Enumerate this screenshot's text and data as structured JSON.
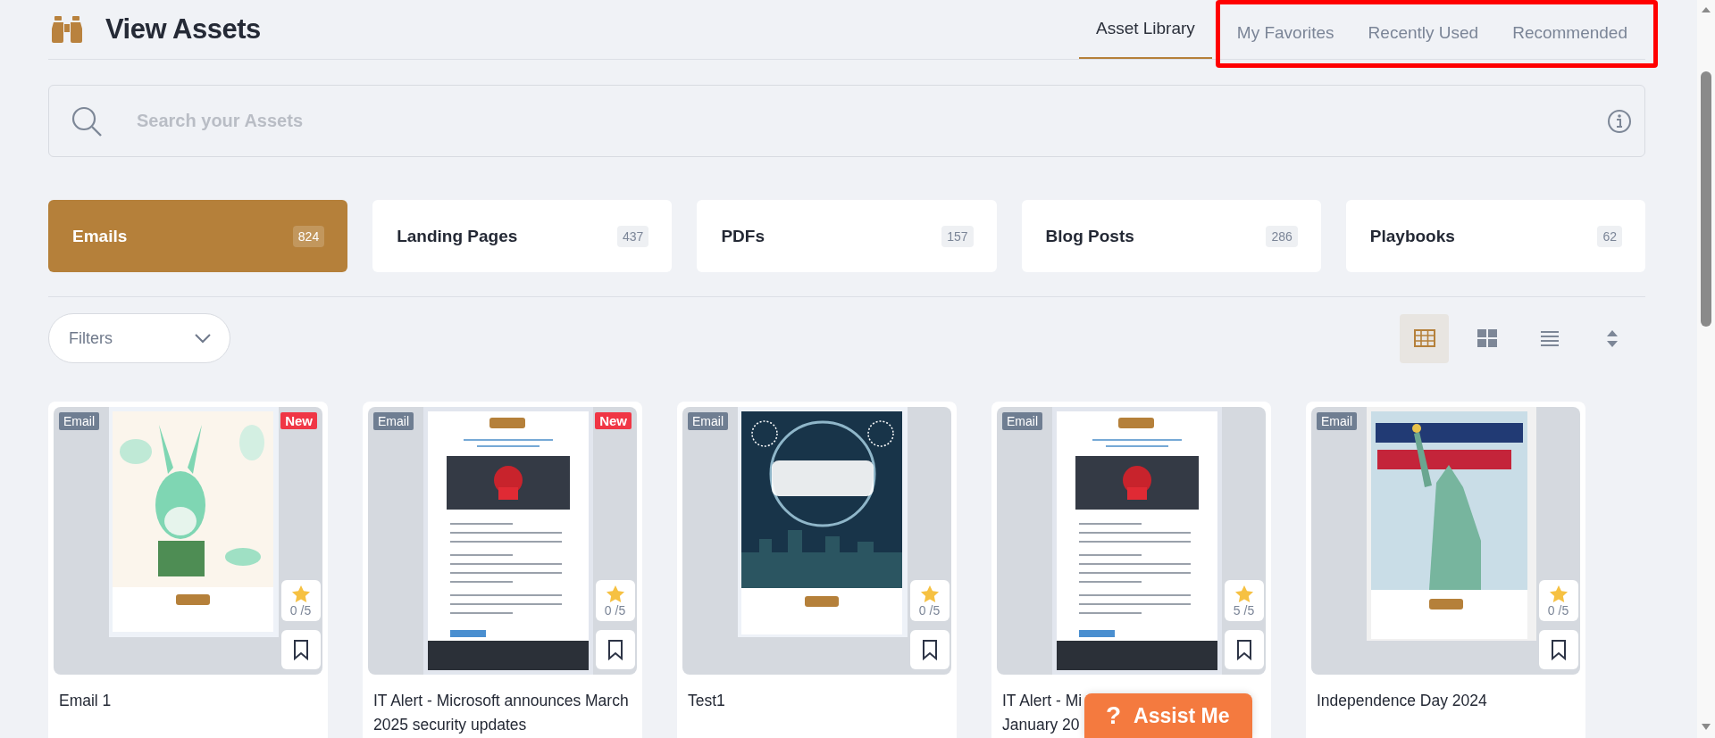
{
  "header": {
    "title": "View Assets"
  },
  "tabs": [
    {
      "label": "Asset Library",
      "selected": true,
      "highlighted": false
    },
    {
      "label": "My Favorites",
      "selected": false,
      "highlighted": true
    },
    {
      "label": "Recently Used",
      "selected": false,
      "highlighted": true
    },
    {
      "label": "Recommended",
      "selected": false,
      "highlighted": true
    }
  ],
  "search": {
    "placeholder": "Search your Assets"
  },
  "categories": [
    {
      "label": "Emails",
      "count": "824",
      "selected": true
    },
    {
      "label": "Landing Pages",
      "count": "437",
      "selected": false
    },
    {
      "label": "PDFs",
      "count": "157",
      "selected": false
    },
    {
      "label": "Blog Posts",
      "count": "286",
      "selected": false
    },
    {
      "label": "Playbooks",
      "count": "62",
      "selected": false
    }
  ],
  "filters": {
    "label": "Filters"
  },
  "view_modes": [
    {
      "kind": "table",
      "selected": true
    },
    {
      "kind": "tiles",
      "selected": false
    },
    {
      "kind": "list",
      "selected": false
    },
    {
      "kind": "sort",
      "selected": false
    }
  ],
  "assets": [
    {
      "type": "Email",
      "badge": "New",
      "preview": {
        "kind": "picture"
      },
      "rating": "0 /5",
      "title_lines": [
        "Email 1"
      ]
    },
    {
      "type": "Email",
      "badge": "New",
      "preview": {
        "kind": "picture"
      },
      "rating": "0 /5",
      "title_lines": [
        "IT Alert - Microsoft announces March",
        "2025 security updates"
      ]
    },
    {
      "type": "Email",
      "preview": {
        "kind": "picture"
      },
      "rating": "0 /5",
      "title_lines": [
        "Test1"
      ]
    },
    {
      "type": "Email",
      "preview": {
        "kind": "picture"
      },
      "rating": "5 /5",
      "title_lines": [
        "IT Alert - Mi",
        "January 20"
      ]
    },
    {
      "type": "Email",
      "preview": {
        "kind": "picture"
      },
      "rating": "0 /5",
      "title_lines": [
        "Independence Day 2024"
      ]
    }
  ],
  "assist": {
    "icon": "?",
    "label": "Assist Me"
  }
}
